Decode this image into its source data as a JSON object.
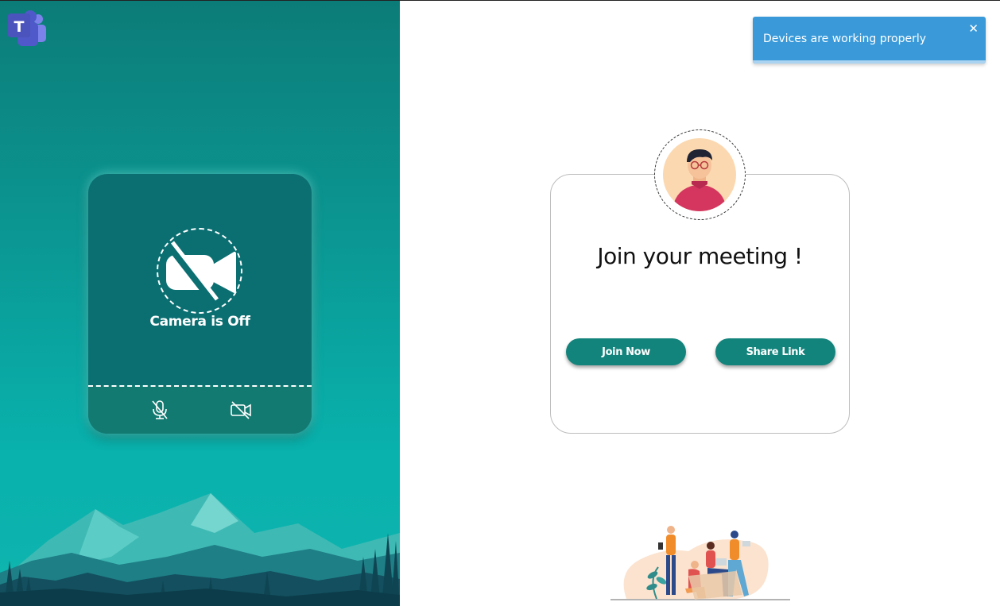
{
  "app": {
    "logo_letter": "T",
    "brand_color": "#5059c9"
  },
  "preview": {
    "camera_status": "Camera is Off",
    "mic_icon": "mic-off-icon",
    "cam_icon": "video-off-icon",
    "accent": "#0b6f72"
  },
  "notification": {
    "message": "Devices are working properly",
    "close": "✕",
    "color": "#3a9ad9"
  },
  "join": {
    "title": "Join your meeting !",
    "join_button": "Join Now",
    "share_button": "Share Link",
    "button_color": "#12847c"
  }
}
